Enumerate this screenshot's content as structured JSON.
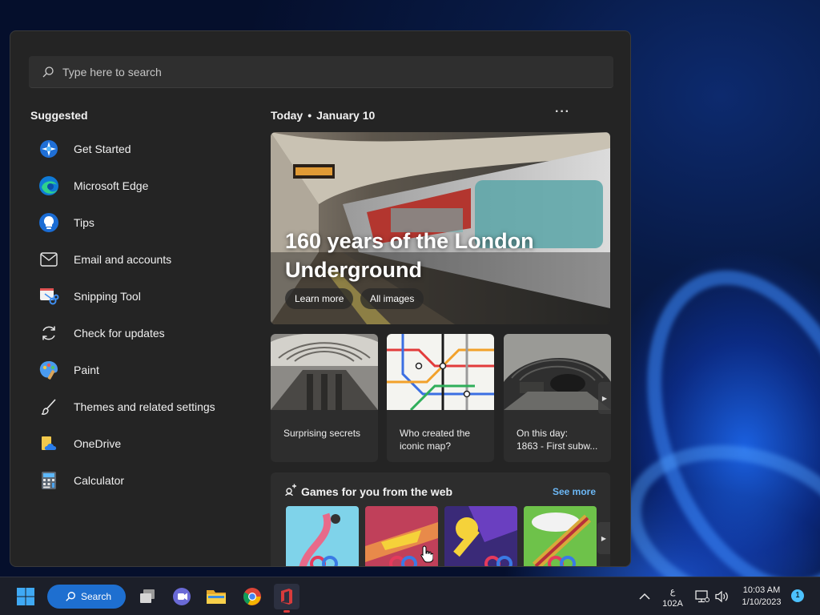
{
  "search": {
    "placeholder": "Type here to search"
  },
  "suggested": {
    "title": "Suggested",
    "items": [
      {
        "label": "Get Started",
        "icon": "get-started-icon"
      },
      {
        "label": "Microsoft Edge",
        "icon": "edge-icon"
      },
      {
        "label": "Tips",
        "icon": "tips-icon"
      },
      {
        "label": "Email and accounts",
        "icon": "mail-icon"
      },
      {
        "label": "Snipping Tool",
        "icon": "snipping-tool-icon"
      },
      {
        "label": "Check for updates",
        "icon": "refresh-icon"
      },
      {
        "label": "Paint",
        "icon": "paint-icon"
      },
      {
        "label": "Themes and related settings",
        "icon": "brush-icon"
      },
      {
        "label": "OneDrive",
        "icon": "onedrive-icon"
      },
      {
        "label": "Calculator",
        "icon": "calculator-icon"
      }
    ]
  },
  "news": {
    "today": "Today",
    "date": "January 10",
    "more": "···",
    "hero": {
      "title": "160 years of the London Underground",
      "learn_more": "Learn more",
      "all_images": "All images"
    },
    "cards": [
      {
        "label": "Surprising secrets"
      },
      {
        "label": "Who created the iconic map?"
      },
      {
        "label": "On this day:",
        "sublabel": "1863 - First subw..."
      }
    ]
  },
  "games": {
    "title": "Games for you from the web",
    "see_more": "See more"
  },
  "taskbar": {
    "search_label": "Search",
    "lang_top": "ع",
    "lang_bottom": "102A",
    "time": "10:03 AM",
    "date": "1/10/2023",
    "notification_count": "1"
  },
  "colors": {
    "accent": "#1e6fd0",
    "link": "#6cb8f6",
    "panel": "#242424"
  }
}
